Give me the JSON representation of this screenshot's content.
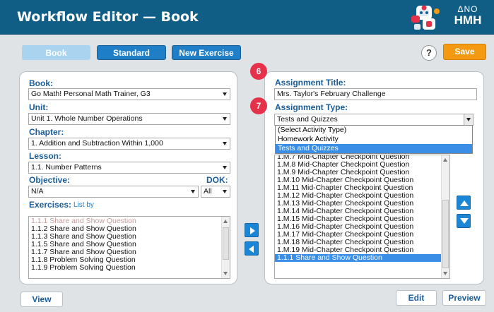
{
  "app": {
    "title": "Workflow Editor — Book",
    "logo_text": "HMH",
    "logo_symbol": "ΔΝΟ"
  },
  "tabs": {
    "book": "Book",
    "standard": "Standard",
    "new_exercise": "New Exercise"
  },
  "help_label": "?",
  "save_label": "Save",
  "left": {
    "book_label": "Book:",
    "book_value": "Go Math! Personal Math Trainer, G3",
    "unit_label": "Unit:",
    "unit_value": "Unit 1. Whole Number Operations",
    "chapter_label": "Chapter:",
    "chapter_value": "1. Addition and Subtraction Within 1,000",
    "lesson_label": "Lesson:",
    "lesson_value": "1.1. Number Patterns",
    "objective_label": "Objective:",
    "objective_value": "N/A",
    "dok_label": "DOK:",
    "dok_value": "All",
    "exercises_label": "Exercises:",
    "listby_label": "List by",
    "exercises": [
      {
        "text": "1.1.1 Share and Show Question",
        "muted": true
      },
      {
        "text": "1.1.2 Share and Show Question",
        "muted": false
      },
      {
        "text": "1.1.3 Share and Show Question",
        "muted": false
      },
      {
        "text": "1.1.5 Share and Show Question",
        "muted": false
      },
      {
        "text": "1.1.7 Share and Show Question",
        "muted": false
      },
      {
        "text": "1.1.8 Problem Solving Question",
        "muted": false
      },
      {
        "text": "1.1.9 Problem Solving Question",
        "muted": false
      }
    ]
  },
  "right": {
    "badge_title": "6",
    "badge_type": "7",
    "title_label": "Assignment Title:",
    "title_value": "Mrs. Taylor's February Challenge",
    "type_label": "Assignment Type:",
    "type_value": "Tests and Quizzes",
    "type_options": [
      {
        "text": "(Select Activity Type)",
        "selected": false
      },
      {
        "text": "Homework Activity",
        "selected": false
      },
      {
        "text": "Tests and Quizzes",
        "selected": true
      }
    ],
    "assigned": [
      {
        "text": "1.M.7 Mid-Chapter Checkpoint Question",
        "selected": false
      },
      {
        "text": "1.M.8 Mid-Chapter Checkpoint Question",
        "selected": false
      },
      {
        "text": "1.M.9 Mid-Chapter Checkpoint Question",
        "selected": false
      },
      {
        "text": "1.M.10 Mid-Chapter Checkpoint Question",
        "selected": false
      },
      {
        "text": "1.M.11 Mid-Chapter Checkpoint Question",
        "selected": false
      },
      {
        "text": "1.M.12 Mid-Chapter Checkpoint Question",
        "selected": false
      },
      {
        "text": "1.M.13 Mid-Chapter Checkpoint Question",
        "selected": false
      },
      {
        "text": "1.M.14 Mid-Chapter Checkpoint Question",
        "selected": false
      },
      {
        "text": "1.M.15 Mid-Chapter Checkpoint Question",
        "selected": false
      },
      {
        "text": "1.M.16 Mid-Chapter Checkpoint Question",
        "selected": false
      },
      {
        "text": "1.M.17 Mid-Chapter Checkpoint Question",
        "selected": false
      },
      {
        "text": "1.M.18 Mid-Chapter Checkpoint Question",
        "selected": false
      },
      {
        "text": "1.M.19 Mid-Chapter Checkpoint Question",
        "selected": false
      },
      {
        "text": "1.1.1 Share and Show Question",
        "selected": true
      }
    ]
  },
  "footer": {
    "view": "View",
    "edit": "Edit",
    "preview": "Preview"
  },
  "colors": {
    "header": "#105d86",
    "label": "#1a5d9a",
    "accent_blue": "#1e7fc8",
    "save": "#f39a12",
    "badge": "#e5314a",
    "selection": "#3a8ee6"
  }
}
